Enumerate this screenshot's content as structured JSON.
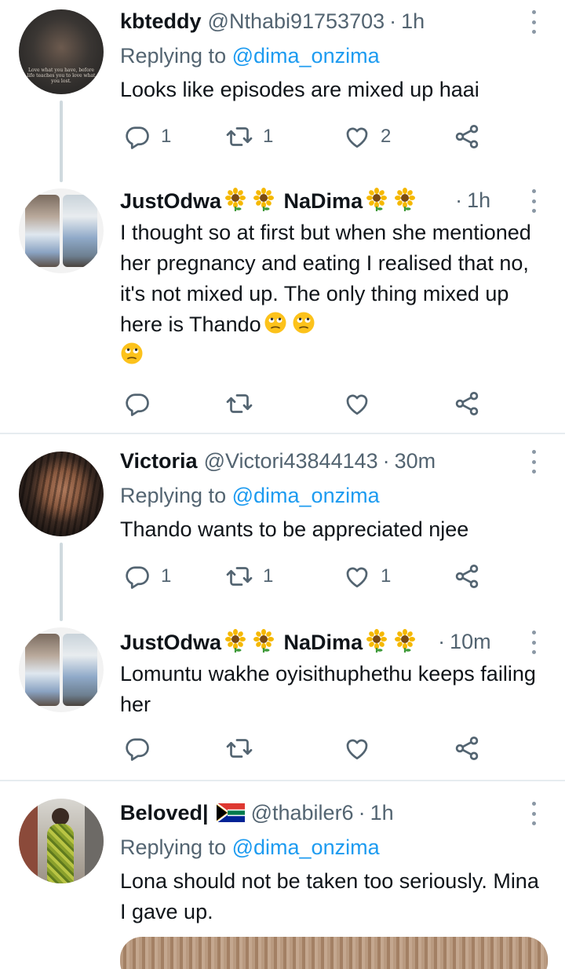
{
  "replies": [
    {
      "name": "kbteddy",
      "handle": "@Nthabi91753703",
      "separator": "·",
      "time": "1h",
      "replying_label": "Replying to",
      "replying_to": "@dima_onzima",
      "text": "Looks like episodes are mixed up haai",
      "avatar_text": "Love what you have, before life teaches you to love what you lost.",
      "reply_count": "1",
      "retweet_count": "1",
      "like_count": "2"
    },
    {
      "name_part1": "JustOdwa",
      "name_part2": "NaDima",
      "separator": "·",
      "time": "1h",
      "text": "I thought so at first but when she mentioned her pregnancy and eating I realised that no, it's not mixed up. The only thing mixed up here is Thando"
    },
    {
      "name": "Victoria",
      "handle": "@Victori43844143",
      "separator": "·",
      "time": "30m",
      "replying_label": "Replying to",
      "replying_to": "@dima_onzima",
      "text": "Thando wants to be appreciated njee",
      "reply_count": "1",
      "retweet_count": "1",
      "like_count": "1"
    },
    {
      "name_part1": "JustOdwa",
      "name_part2": "NaDima",
      "separator": "·",
      "time": "10m",
      "text": "Lomuntu wakhe oyisithuphethu keeps failing her"
    },
    {
      "name": "Beloved|",
      "handle": "@thabiler6",
      "separator": "·",
      "time": "1h",
      "replying_label": "Replying to",
      "replying_to": "@dima_onzima",
      "text": "Lona should not be taken too seriously. Mina I gave up."
    }
  ],
  "icons": {
    "reply": "reply-icon",
    "retweet": "retweet-icon",
    "like": "heart-icon",
    "share": "share-icon",
    "more": "more-vertical-icon",
    "sunflower": "sunflower-emoji",
    "rolling_eyes": "rolling-eyes-emoji",
    "flag": "south-africa-flag-icon"
  },
  "colors": {
    "link": "#1d9bf0",
    "secondary_text": "#536471",
    "thread_line": "#cfd9de"
  }
}
